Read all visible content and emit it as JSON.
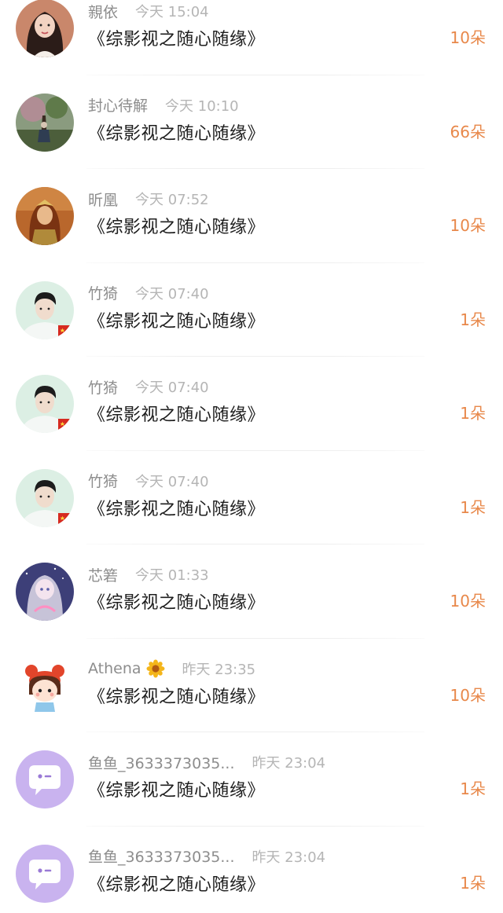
{
  "gift_list": [
    {
      "name": "親依",
      "time": "今天 15:04",
      "book": "《综影视之随心随缘》",
      "amount": "10朵",
      "avatar": "portrait-girl",
      "bg": "#c9876b",
      "skin": "#f2d3c2",
      "hair": "#2b1c18"
    },
    {
      "name": "封心待解",
      "time": "今天 10:10",
      "book": "《综影视之随心随缘》",
      "amount": "66朵",
      "avatar": "scene-tree",
      "bg": "#6c7a5c",
      "skin": "#d7c6b4",
      "hair": "#3a2a30"
    },
    {
      "name": "昕凰",
      "time": "今天 07:52",
      "book": "《综影视之随心随缘》",
      "amount": "10朵",
      "avatar": "warrior",
      "bg": "#b9672c",
      "skin": "#e8b98b",
      "hair": "#7a3312"
    },
    {
      "name": "竹猗",
      "time": "今天 07:40",
      "book": "《综影视之随心随缘》",
      "amount": "1朵",
      "avatar": "portrait-boy",
      "bg": "#dcefe4",
      "skin": "#f0dccd",
      "hair": "#1c1c1c"
    },
    {
      "name": "竹猗",
      "time": "今天 07:40",
      "book": "《综影视之随心随缘》",
      "amount": "1朵",
      "avatar": "portrait-boy",
      "bg": "#dcefe4",
      "skin": "#f0dccd",
      "hair": "#1c1c1c"
    },
    {
      "name": "竹猗",
      "time": "今天 07:40",
      "book": "《综影视之随心随缘》",
      "amount": "1朵",
      "avatar": "portrait-boy",
      "bg": "#dcefe4",
      "skin": "#f0dccd",
      "hair": "#1c1c1c"
    },
    {
      "name": "芯箬",
      "time": "今天 01:33",
      "book": "《综影视之随心随缘》",
      "amount": "10朵",
      "avatar": "anime-girl",
      "bg": "#3d3f78",
      "skin": "#f4e4ee",
      "hair": "#c7c3d8"
    },
    {
      "name": "Athena",
      "badge": true,
      "time": "昨天 23:35",
      "book": "《综影视之随心随缘》",
      "amount": "10朵",
      "avatar": "cartoon-girl",
      "bg": "#ffffff",
      "skin": "#fde3d3",
      "hair": "#5a2c1a"
    },
    {
      "name": "鱼鱼_3633373035...",
      "time": "昨天 23:04",
      "book": "《综影视之随心随缘》",
      "amount": "1朵",
      "avatar": "default-chat",
      "bg": "#c9b3ef",
      "skin": "#ffffff",
      "hair": "#9a7ad6"
    },
    {
      "name": "鱼鱼_3633373035...",
      "time": "昨天 23:04",
      "book": "《综影视之随心随缘》",
      "amount": "1朵",
      "avatar": "default-chat",
      "bg": "#c9b3ef",
      "skin": "#ffffff",
      "hair": "#9a7ad6"
    }
  ],
  "colors": {
    "amount": "#e8884a",
    "name": "#8d8d8d",
    "time": "#b5b5b5"
  }
}
